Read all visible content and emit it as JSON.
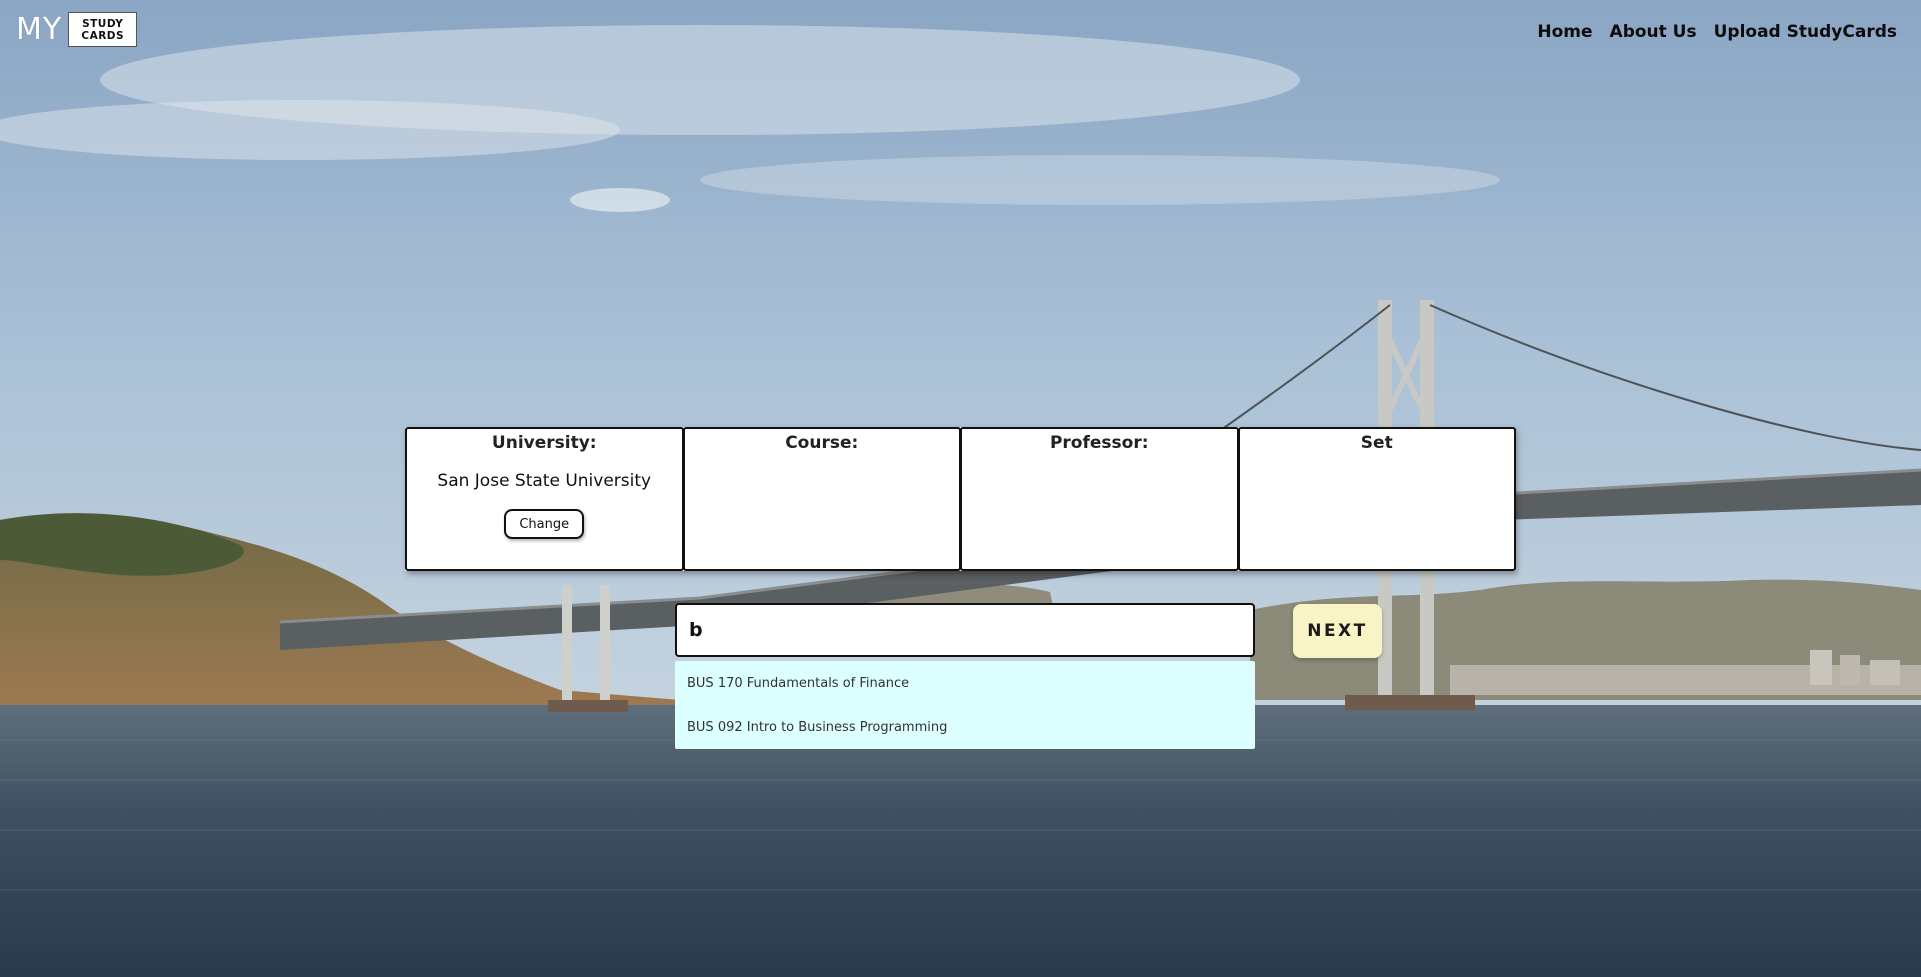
{
  "header": {
    "logo_my": "MY",
    "logo_line1": "STUDY",
    "logo_line2": "CARDS",
    "nav": [
      "Home",
      "About Us",
      "Upload StudyCards"
    ]
  },
  "panel": {
    "university": {
      "title": "University:",
      "value": "San Jose State University",
      "change_label": "Change"
    },
    "course": {
      "title": "Course:",
      "value": ""
    },
    "professor": {
      "title": "Professor:",
      "value": ""
    },
    "set": {
      "title": "Set",
      "value": ""
    }
  },
  "search": {
    "value": "b",
    "next_label": "NEXT",
    "suggestions": [
      "BUS 170 Fundamentals of Finance",
      "BUS 092 Intro to Business Programming"
    ]
  },
  "colors": {
    "next_button_bg": "#f8f4c6",
    "suggestions_bg": "#dcffff"
  }
}
